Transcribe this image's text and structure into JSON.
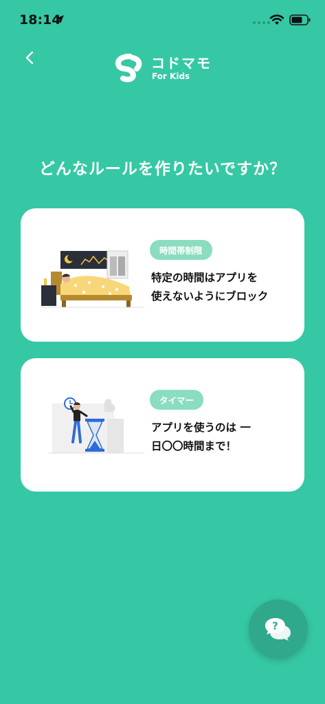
{
  "status_bar": {
    "time": "18:14",
    "icons": [
      "location-arrow-icon",
      "wifi-icon",
      "battery-icon"
    ]
  },
  "header": {
    "back_icon": "chevron-left-icon",
    "logo_name": "コドマモ",
    "logo_sub": "For Kids"
  },
  "question": "どんなルールを作りたいですか？",
  "cards": [
    {
      "tag": "時間帯制限",
      "line1": "特定の時間はアプリを",
      "line2": "使えないようにブロック",
      "illustration": "sleeping-in-bed-illustration"
    },
    {
      "tag": "タイマー",
      "line1": "アプリを使うのは 一",
      "line2": "日〇〇時間まで！",
      "illustration": "man-with-hourglass-clock-illustration"
    }
  ],
  "help_fab": {
    "icon": "question-chat-bubble-icon"
  },
  "colors": {
    "background": "#36C8A4",
    "tag": "#8ADDBF",
    "fab": "#2FA88C",
    "card": "#FFFFFF"
  }
}
